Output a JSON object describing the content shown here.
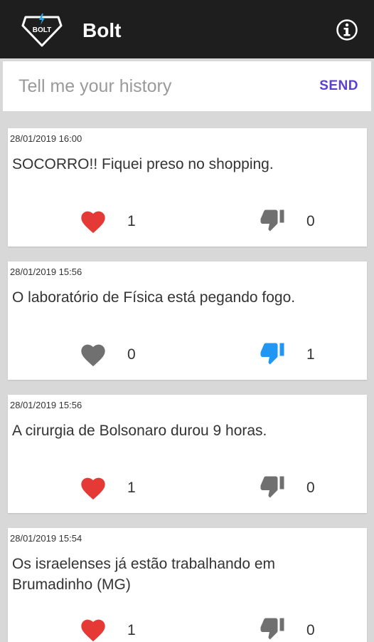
{
  "app": {
    "title": "Bolt",
    "logo_text": "BOLT"
  },
  "composer": {
    "placeholder": "Tell me your history",
    "send_label": "SEND"
  },
  "colors": {
    "liked": "#e53935",
    "neutral": "#707070",
    "disliked": "#2196f3",
    "accent": "#5b3fd3"
  },
  "posts": [
    {
      "date": "28/01/2019 16:00",
      "text": "SOCORRO!! Fiquei preso no shopping.",
      "likes": "1",
      "dislikes": "0",
      "liked": true,
      "disliked": false
    },
    {
      "date": "28/01/2019 15:56",
      "text": "O laboratório de Física está pegando fogo.",
      "likes": "0",
      "dislikes": "1",
      "liked": false,
      "disliked": true
    },
    {
      "date": "28/01/2019 15:56",
      "text": "A cirurgia de Bolsonaro durou 9 horas.",
      "likes": "1",
      "dislikes": "0",
      "liked": true,
      "disliked": false
    },
    {
      "date": "28/01/2019 15:54",
      "text": "Os israelenses já estão trabalhando em Brumadinho (MG)",
      "likes": "1",
      "dislikes": "0",
      "liked": true,
      "disliked": false
    }
  ]
}
